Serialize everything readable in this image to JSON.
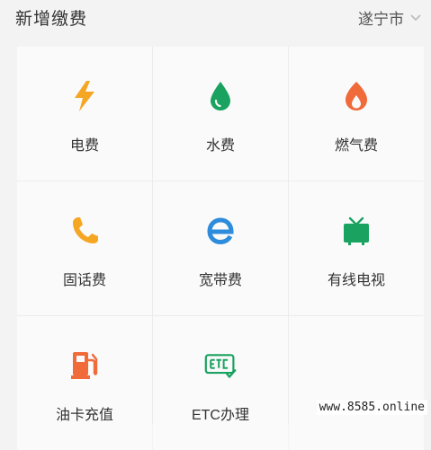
{
  "header": {
    "title": "新增缴费",
    "city": "遂宁市"
  },
  "services": [
    {
      "label": "电费",
      "icon": "lightning-icon",
      "color": "#F5A623"
    },
    {
      "label": "水费",
      "icon": "water-drop-icon",
      "color": "#1AA260"
    },
    {
      "label": "燃气费",
      "icon": "flame-icon",
      "color": "#F06A3A"
    },
    {
      "label": "固话费",
      "icon": "phone-icon",
      "color": "#F5A623"
    },
    {
      "label": "宽带费",
      "icon": "ie-browser-icon",
      "color": "#2D8CDB"
    },
    {
      "label": "有线电视",
      "icon": "tv-icon",
      "color": "#1AA260"
    },
    {
      "label": "油卡充值",
      "icon": "fuel-pump-icon",
      "color": "#F06A3A"
    },
    {
      "label": "ETC办理",
      "icon": "etc-icon",
      "color": "#1AA260"
    }
  ],
  "watermark": "www.8585.online"
}
